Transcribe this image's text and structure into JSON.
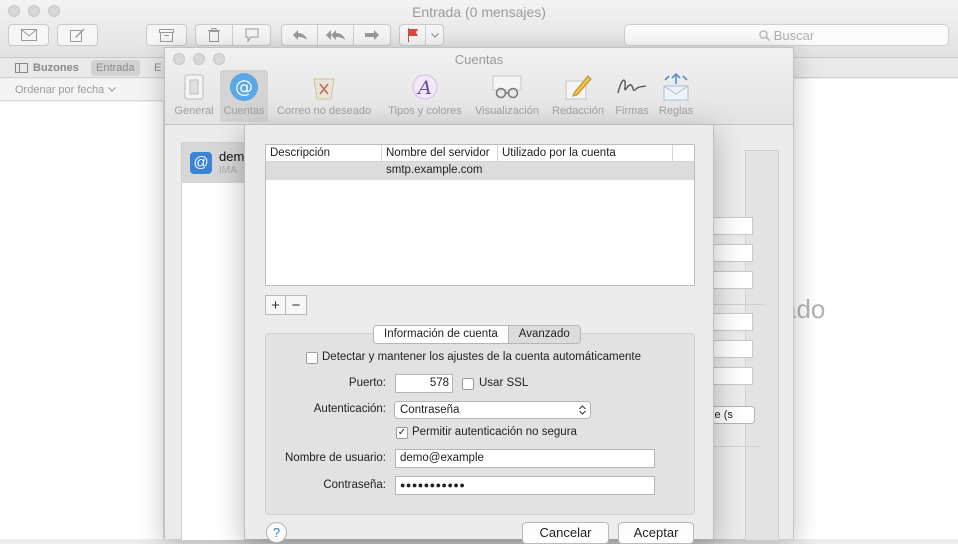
{
  "main_window": {
    "title": "Entrada (0 mensajes)",
    "search": {
      "placeholder": "Buscar"
    },
    "favorites": {
      "mailboxes": "Buzones",
      "inbox": "Entrada",
      "truncated": "E"
    },
    "sort_label": "Ordenar por fecha",
    "viewer_text": "ado",
    "toolbar_icons": [
      "envelope-icon",
      "compose-icon",
      "archive-icon",
      "trash-icon",
      "junk-icon",
      "reply-icon",
      "reply-all-icon",
      "forward-icon",
      "flag-icon"
    ]
  },
  "prefs_window": {
    "title": "Cuentas",
    "tabs": [
      {
        "label": "General",
        "icon": "switch-icon"
      },
      {
        "label": "Cuentas",
        "icon": "at-icon",
        "active": true
      },
      {
        "label": "Correo no deseado",
        "icon": "junk-bin-icon"
      },
      {
        "label": "Tipos y colores",
        "icon": "font-icon"
      },
      {
        "label": "Visualización",
        "icon": "glasses-icon"
      },
      {
        "label": "Redacción",
        "icon": "pencil-icon"
      },
      {
        "label": "Firmas",
        "icon": "signature-icon"
      },
      {
        "label": "Reglas",
        "icon": "rules-icon"
      }
    ],
    "account": {
      "name": "dem",
      "type": "IMA",
      "icon_text": "@"
    },
    "detail_popup_text": "ple (s"
  },
  "smtp_sheet": {
    "table": {
      "headers": [
        "Descripción",
        "Nombre del servidor",
        "Utilizado por la cuenta"
      ],
      "rows": [
        {
          "description": "",
          "server": "smtp.example.com",
          "used_by": ""
        }
      ]
    },
    "add_label": "+",
    "remove_label": "−",
    "tabs": {
      "account_info": "Información de cuenta",
      "advanced": "Avanzado"
    },
    "auto_detect": {
      "label": "Detectar y mantener los ajustes de la cuenta automáticamente",
      "checked": false
    },
    "port": {
      "label": "Puerto:",
      "value": "578"
    },
    "use_ssl": {
      "label": "Usar SSL",
      "checked": false
    },
    "auth": {
      "label": "Autenticación:",
      "value": "Contraseña"
    },
    "insecure_auth": {
      "label": "Permitir autenticación no segura",
      "checked": true,
      "mark": "✓"
    },
    "username": {
      "label": "Nombre de usuario:",
      "value": "demo@example"
    },
    "password": {
      "label": "Contraseña:",
      "value": "●●●●●●●●●●●"
    },
    "help_label": "?",
    "cancel_label": "Cancelar",
    "ok_label": "Aceptar"
  }
}
